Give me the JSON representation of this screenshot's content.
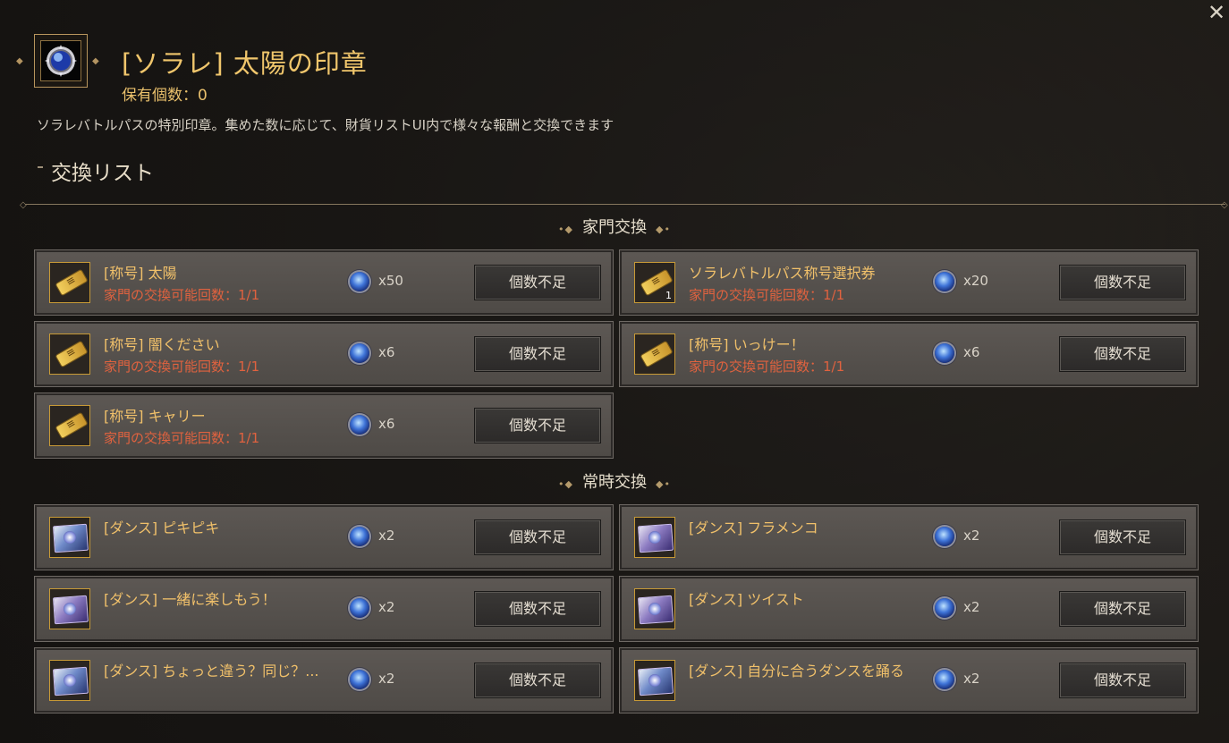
{
  "header": {
    "title": "[ソラレ] 太陽の印章",
    "owned": "保有個数：0",
    "description": "ソラレバトルパスの特別印章。集めた数に応じて、財貨リストUI内で様々な報酬と交換できます",
    "exchange_list_title": "交換リスト",
    "close_label": "✕"
  },
  "groups": [
    {
      "title": "家門交換",
      "items": [
        {
          "name": "[称号] 太陽",
          "limit": "家門の交換可能回数：1/1",
          "cost": "x50",
          "button": "個数不足",
          "icon": "title-ticket-icon"
        },
        {
          "name": "ソラレバトルパス称号選択券",
          "limit": "家門の交換可能回数：1/1",
          "cost": "x20",
          "button": "個数不足",
          "icon": "title-ticket-icon",
          "qty": "1"
        },
        {
          "name": "[称号] 闇ください",
          "limit": "家門の交換可能回数：1/1",
          "cost": "x6",
          "button": "個数不足",
          "icon": "title-ticket-icon"
        },
        {
          "name": "[称号] いっけー！",
          "limit": "家門の交換可能回数：1/1",
          "cost": "x6",
          "button": "個数不足",
          "icon": "title-ticket-icon"
        },
        {
          "name": "[称号] キャリー",
          "limit": "家門の交換可能回数：1/1",
          "cost": "x6",
          "button": "個数不足",
          "icon": "title-ticket-icon"
        }
      ]
    },
    {
      "title": "常時交換",
      "items": [
        {
          "name": "[ダンス] ピキピキ",
          "cost": "x2",
          "button": "個数不足",
          "icon": "dance-card-icon"
        },
        {
          "name": "[ダンス] フラメンコ",
          "cost": "x2",
          "button": "個数不足",
          "icon": "dance-card-icon"
        },
        {
          "name": "[ダンス] 一緒に楽しもう！",
          "cost": "x2",
          "button": "個数不足",
          "icon": "dance-card-icon"
        },
        {
          "name": "[ダンス] ツイスト",
          "cost": "x2",
          "button": "個数不足",
          "icon": "dance-card-icon"
        },
        {
          "name": "[ダンス] ちょっと違う？同じ？...",
          "cost": "x2",
          "button": "個数不足",
          "icon": "dance-card-icon"
        },
        {
          "name": "[ダンス] 自分に合うダンスを踊る",
          "cost": "x2",
          "button": "個数不足",
          "icon": "dance-card-icon"
        }
      ]
    }
  ],
  "colors": {
    "accent_gold": "#f0c06a",
    "limit_red": "#e0623f"
  }
}
